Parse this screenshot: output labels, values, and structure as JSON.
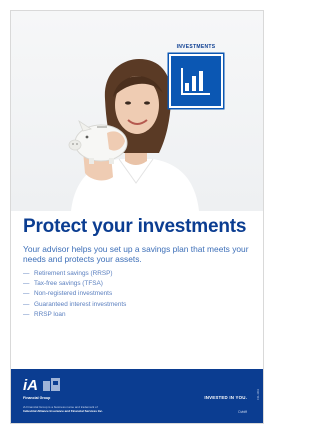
{
  "hero": {
    "badge_label": "INVESTMENTS",
    "badge_icon": "bar-chart-icon"
  },
  "title": "Protect your investments",
  "intro": "Your advisor helps you set up a savings plan that meets your needs and protects your assets.",
  "bullets": [
    "Retirement savings (RRSP)",
    "Tax-free savings (TFSA)",
    "Non-registered investments",
    "Guaranteed interest investments",
    "RRSP loan"
  ],
  "footer": {
    "logo_text": "iA",
    "logo_subtitle": "Financial Group",
    "legal_line1": "iA Financial Group is a business name and trademark of",
    "legal_line2": "Industrial Alliance Insurance and Financial Services Inc.",
    "tagline": "INVESTED IN YOU.",
    "code": "Dvbiff",
    "vertical_code": "F11-1011"
  },
  "colors": {
    "brand_navy": "#0b3d91",
    "badge_blue": "#0b57b3",
    "intro_text": "#3d6fb8",
    "bullet_text": "#5a7fbf"
  }
}
